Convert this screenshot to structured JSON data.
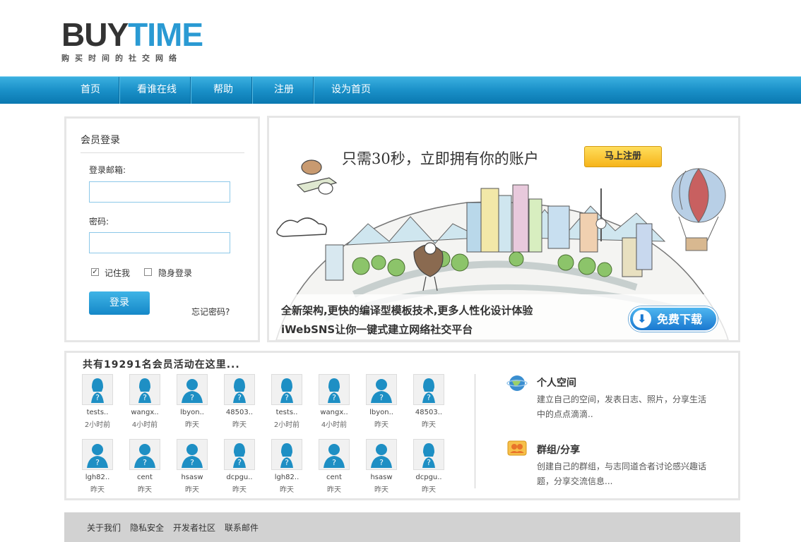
{
  "header": {
    "logo_buy": "BUY",
    "logo_time": "TIME",
    "logo_sub": "购买时间的社交网络"
  },
  "nav": [
    {
      "label": "首页"
    },
    {
      "label": "看谁在线"
    },
    {
      "label": "帮助"
    },
    {
      "label": "注册"
    },
    {
      "label": "设为首页"
    }
  ],
  "login": {
    "title": "会员登录",
    "email_label": "登录邮箱:",
    "email_value": "",
    "password_label": "密码:",
    "password_value": "",
    "remember_label": "记住我",
    "remember_checked": true,
    "invisible_label": "隐身登录",
    "invisible_checked": false,
    "submit_label": "登录",
    "forgot_label": "忘记密码?"
  },
  "banner": {
    "headline": "只需30秒，立即拥有你的账户",
    "register_button": "马上注册",
    "line1": "全新架构,更快的编译型模板技术,更多人性化设计体验",
    "line2": "iWebSNS让你一键式建立网络社交平台",
    "download_button": "免费下载"
  },
  "members": {
    "title": "共有19291名会员活动在这里...",
    "list": [
      {
        "name": "tests..",
        "time": "2小时前"
      },
      {
        "name": "wangx..",
        "time": "4小时前"
      },
      {
        "name": "lbyon..",
        "time": "昨天"
      },
      {
        "name": "48503..",
        "time": "昨天"
      },
      {
        "name": "tests..",
        "time": "2小时前"
      },
      {
        "name": "wangx..",
        "time": "4小时前"
      },
      {
        "name": "lbyon..",
        "time": "昨天"
      },
      {
        "name": "48503..",
        "time": "昨天"
      },
      {
        "name": "lgh82..",
        "time": "昨天"
      },
      {
        "name": "cent",
        "time": "昨天"
      },
      {
        "name": "hsasw",
        "time": "昨天"
      },
      {
        "name": "dcpgu..",
        "time": "昨天"
      },
      {
        "name": "lgh82..",
        "time": "昨天"
      },
      {
        "name": "cent",
        "time": "昨天"
      },
      {
        "name": "hsasw",
        "time": "昨天"
      },
      {
        "name": "dcpgu..",
        "time": "昨天"
      }
    ]
  },
  "features": [
    {
      "title": "个人空间",
      "desc": "建立自己的空间，发表日志、照片，分享生活中的点点滴滴..",
      "icon": "globe-icon"
    },
    {
      "title": "群组/分享",
      "desc": "创建自己的群组，与志同道合者讨论感兴趣话题，分享交流信息...",
      "icon": "group-icon"
    }
  ],
  "footer": [
    {
      "label": "关于我们"
    },
    {
      "label": "隐私安全"
    },
    {
      "label": "开发者社区"
    },
    {
      "label": "联系邮件"
    }
  ],
  "colors": {
    "nav_blue": "#1a90c8",
    "accent_blue": "#2a9ad3",
    "register_yellow": "#f6b41a",
    "footer_gray": "#d2d2d2"
  }
}
